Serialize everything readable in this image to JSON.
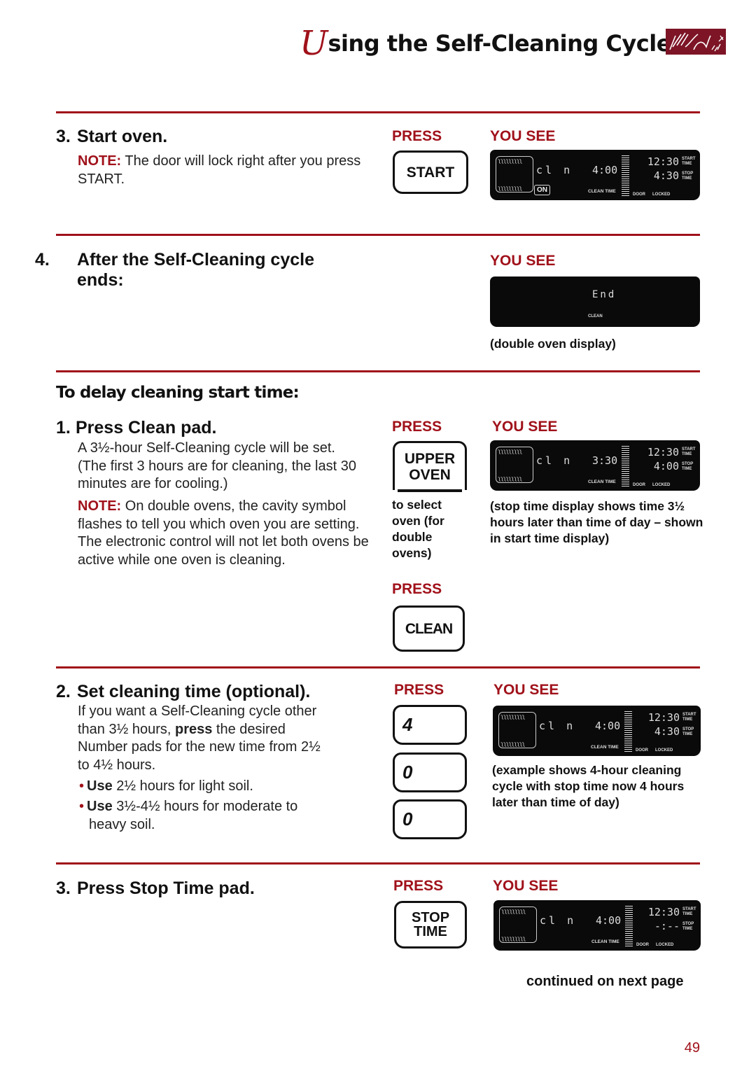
{
  "header": {
    "title_initial": "U",
    "title_rest": "sing the Self-Cleaning Cycle",
    "logo_icon": "brand-logo-icon"
  },
  "colors": {
    "accent": "#a0111a",
    "logo_bg": "#7d1526",
    "lcd_bg": "#0a0a0a"
  },
  "labels": {
    "press": "PRESS",
    "you_see": "YOU SEE"
  },
  "step3_start": {
    "number": "3.",
    "title": "Start oven.",
    "note_label": "NOTE:",
    "note_text": " The door will lock right after you press START.",
    "pad": "START",
    "display": {
      "mode": "cl n",
      "on": "ON",
      "clean_time": "4:00",
      "clean_label": "CLEAN TIME",
      "start_time": "12:30",
      "start_label": "START TIME",
      "stop_time": "4:30",
      "stop_label": "STOP TIME",
      "door": "DOOR",
      "locked": "LOCKED"
    }
  },
  "step4_end": {
    "number": "4.",
    "title": "After the Self-Cleaning cycle ends:",
    "display": {
      "value": "End",
      "label": "CLEAN"
    },
    "caption": "(double oven display)"
  },
  "delay": {
    "heading": "To delay cleaning start time:",
    "step1": {
      "number": "1.",
      "title": "Press Clean pad.",
      "text": "A 3½-hour Self-Cleaning cycle will be set. (The first 3 hours are for cleaning, the last 30 minutes are for cooling.)",
      "note_label": "NOTE:",
      "note_text": " On double ovens, the cavity symbol flashes to tell you which oven you are setting. The electronic control will not let both ovens be active while one oven is cleaning.",
      "pad_upper_line1": "UPPER",
      "pad_upper_line2": "OVEN",
      "pad_upper_caption": "to select oven (for double ovens)",
      "pad_clean": "CLEAN",
      "display": {
        "mode": "cl n",
        "clean_time": "3:30",
        "clean_label": "CLEAN TIME",
        "start_time": "12:30",
        "start_label": "START TIME",
        "stop_time": "4:00",
        "stop_label": "STOP TIME",
        "door": "DOOR",
        "locked": "LOCKED"
      },
      "caption": "(stop time display shows time 3½ hours later than time of day – shown in start time display)"
    },
    "step2": {
      "number": "2.",
      "title": "Set cleaning time (optional).",
      "text_a": "If you want a Self-Cleaning cycle other than 3½ hours, ",
      "text_bold": "press",
      "text_b": " the desired Number pads for the new time from 2½ to 4½ hours.",
      "bullets": [
        {
          "bold": "Use",
          "text": " 2½ hours for light soil."
        },
        {
          "bold": "Use",
          "text": " 3½-4½ hours for moderate to heavy soil."
        }
      ],
      "pads": [
        "4",
        "0",
        "0"
      ],
      "display": {
        "mode": "cl n",
        "clean_time": "4:00",
        "clean_label": "CLEAN TIME",
        "start_time": "12:30",
        "start_label": "START TIME",
        "stop_time": "4:30",
        "stop_label": "STOP TIME",
        "door": "DOOR",
        "locked": "LOCKED"
      },
      "caption": "(example shows 4-hour cleaning cycle with stop time now 4 hours later than time of day)"
    },
    "step3": {
      "number": "3.",
      "title": "Press Stop Time pad.",
      "pad_line1": "STOP",
      "pad_line2": "TIME",
      "display": {
        "mode": "cl n",
        "clean_time": "4:00",
        "clean_label": "CLEAN TIME",
        "start_time": "12:30",
        "start_label": "START TIME",
        "stop_time": "-:--",
        "stop_label": "STOP TIME",
        "door": "DOOR",
        "locked": "LOCKED"
      }
    }
  },
  "footer": {
    "continued": "continued on next page",
    "page_number": "49"
  }
}
